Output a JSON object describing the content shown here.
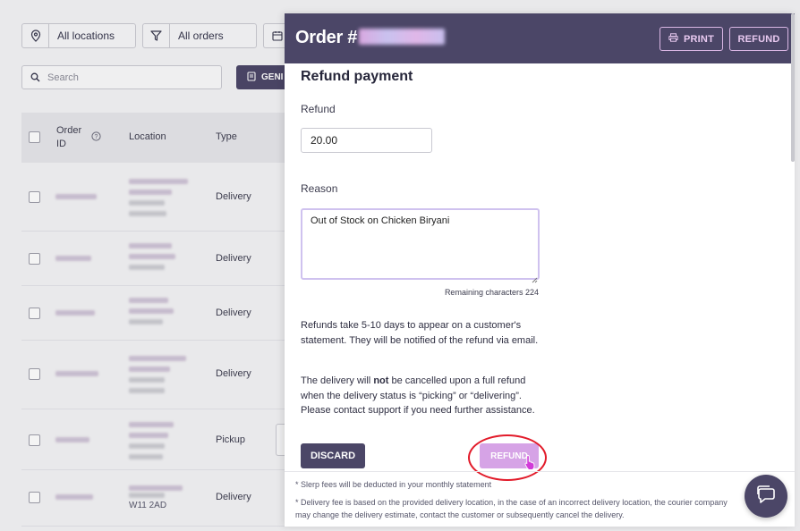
{
  "filters": {
    "locations_label": "All locations",
    "orders_label": "All orders"
  },
  "search": {
    "placeholder": "Search"
  },
  "generate_button": {
    "label": "GENI"
  },
  "table": {
    "headers": {
      "order_id": "Order ID",
      "location": "Location",
      "type": "Type"
    },
    "rows": [
      {
        "type": "Delivery"
      },
      {
        "type": "Delivery"
      },
      {
        "type": "Delivery"
      },
      {
        "type": "Delivery"
      },
      {
        "type": "Pickup"
      },
      {
        "type": "Delivery",
        "postcode": "W11 2AD"
      }
    ]
  },
  "drawer": {
    "order_prefix": "Order #",
    "print_label": "PRINT",
    "refund_header_label": "REFUND",
    "section_title": "Refund payment",
    "refund_label": "Refund",
    "refund_amount": "20.00",
    "reason_label": "Reason",
    "reason_text": "Out of Stock on Chicken Biryani",
    "remaining": "Remaining characters 224",
    "info_text": "Refunds take 5-10 days to appear on a customer's statement. They will be notified of the refund via email.",
    "delivery_note_pre": "The delivery will ",
    "delivery_note_bold": "not",
    "delivery_note_post": " be cancelled upon a full refund when the delivery status is “picking” or “delivering”. Please contact support if you need further assistance.",
    "discard_label": "DISCARD",
    "refund_label_btn": "REFUND",
    "footer_line1": "* Slerp fees will be deducted in your monthly statement",
    "footer_line2": "* Delivery fee is based on the provided delivery location, in the case of an incorrect delivery location, the courier company",
    "footer_line3": "may change the delivery estimate, contact the customer or subsequently cancel the delivery."
  },
  "colors": {
    "header_bg": "#4b4667",
    "refund_button": "#d6a3e6",
    "highlight_ring": "#e21b2a"
  }
}
